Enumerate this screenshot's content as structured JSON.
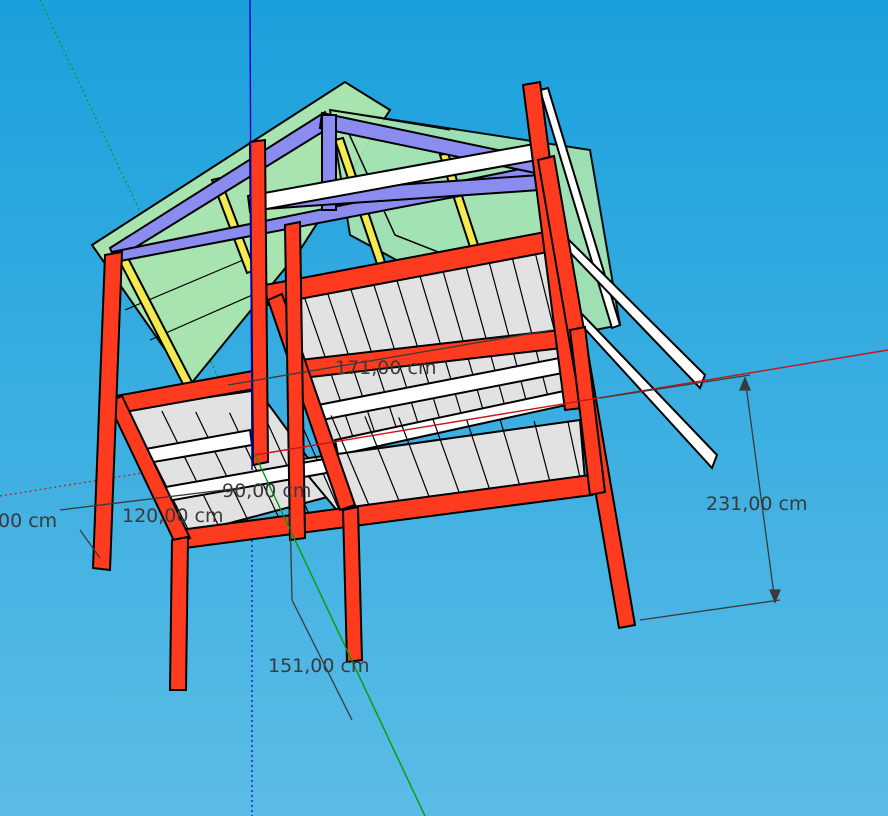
{
  "viewport": {
    "sky_top": "#1aa0dc",
    "sky_bottom": "#5bbce6",
    "axes": {
      "red": "#c4161c",
      "green": "#00a000",
      "blue": "#0000c8"
    },
    "colors": {
      "post": "#ff3b1f",
      "rafter": "#8a8cf0",
      "roof": "#a8e4b0",
      "strut": "#f4ea50",
      "slat": "#e2e2e2",
      "white_beam": "#ffffff",
      "outline": "#000000"
    }
  },
  "dimensions": [
    {
      "id": "dim-171",
      "label": "171,00 cm"
    },
    {
      "id": "dim-231",
      "label": "231,00 cm"
    },
    {
      "id": "dim-151",
      "label": "151,00 cm"
    },
    {
      "id": "dim-120",
      "label": "120,00 cm"
    },
    {
      "id": "dim-90",
      "label": "90,00 cm"
    },
    {
      "id": "dim-left",
      "label": "00 cm"
    }
  ]
}
